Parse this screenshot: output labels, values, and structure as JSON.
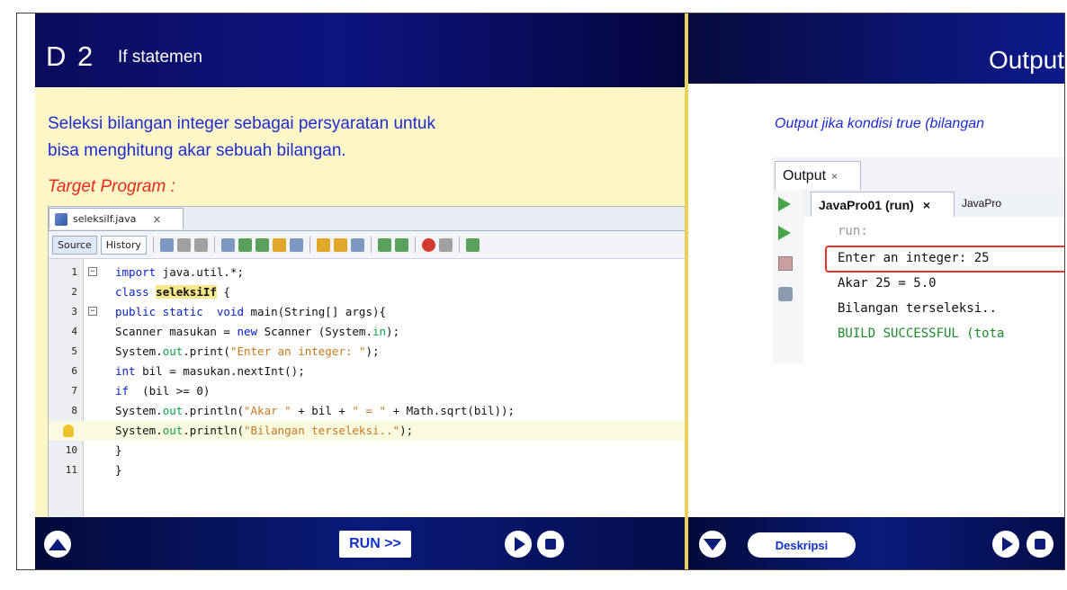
{
  "left_slide": {
    "number": "D 2",
    "title": "If statemen",
    "intro_line1": "Seleksi bilangan integer sebagai persyaratan untuk",
    "intro_line2": "bisa menghitung akar sebuah bilangan.",
    "target_label": "Target Program :",
    "ide": {
      "file_tab": "seleksiIf.java",
      "close_glyph": "×",
      "toolbar_source": "Source",
      "toolbar_history": "History",
      "lines": [
        {
          "n": "1",
          "pre": "",
          "kw": "import",
          "post": " java.util.*;"
        },
        {
          "n": "2",
          "pre": "",
          "kw": "class",
          "post": " "
        },
        {
          "n": "3",
          "pre": "",
          "kw": "public static  void",
          "post": " main(String[] args){"
        },
        {
          "n": "4",
          "pre": "Scanner masukan = ",
          "kw": "new",
          "post": " Scanner (System.in);"
        },
        {
          "n": "5",
          "pre": "System.",
          "kw": "",
          "post": "out.print(\"Enter an integer: \");"
        },
        {
          "n": "6",
          "pre": "",
          "kw": "int",
          "post": " bil = masukan.nextInt();"
        },
        {
          "n": "7",
          "pre": "",
          "kw": "if",
          "post": "  (bil >= 0)"
        },
        {
          "n": "8",
          "pre": "System.",
          "kw": "",
          "post": "out.println(\"Akar \" + bil + \" = \" + Math.sqrt(bil));"
        },
        {
          "n": "",
          "pre": "System.",
          "kw": "",
          "post": "out.println(\"Bilangan terseleksi..\");"
        },
        {
          "n": "10",
          "pre": "}",
          "kw": "",
          "post": ""
        },
        {
          "n": "11",
          "pre": "}",
          "kw": "",
          "post": ""
        }
      ],
      "class_name": "seleksiIf",
      "class_brace": " {",
      "sys_in": "in",
      "out_kw": "out",
      "str_enter": "\"Enter an integer: \"",
      "str_akar": "\"Akar \"",
      "str_eq": "\" = \"",
      "str_bil": "\"Bilangan terseleksi..\""
    },
    "run_button": "RUN >>"
  },
  "right_slide": {
    "title": "Output",
    "caption": "Output jika kondisi true (bilangan",
    "output_tab": "Output",
    "close_glyph": "×",
    "run_tab": "JavaPro01 (run)",
    "run_tab2": "JavaPro",
    "console": {
      "line1": "run:",
      "line2": "Enter an integer: 25",
      "line3": "Akar 25 = 5.0",
      "line4": "Bilangan terseleksi..",
      "line5": "BUILD SUCCESSFUL (tota"
    },
    "deskripsi_button": "Deskripsi"
  },
  "colors": {
    "header_navy": "#0b1470",
    "slide_yellow": "#fdf7c8",
    "intro_blue": "#1e2bd6",
    "target_red": "#ea2a1c",
    "highlight_box": "#e8342a"
  }
}
